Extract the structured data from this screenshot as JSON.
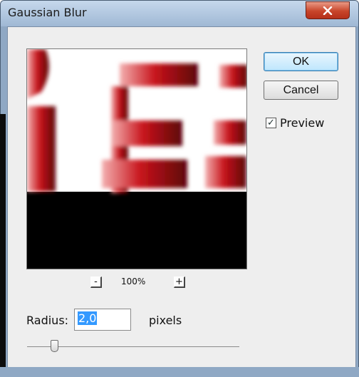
{
  "dialog": {
    "title": "Gaussian Blur",
    "close_icon": "close-icon"
  },
  "buttons": {
    "ok": "OK",
    "cancel": "Cancel"
  },
  "preview_checkbox": {
    "label": "Preview",
    "checked": true
  },
  "zoom": {
    "minus": "-",
    "level": "100%",
    "plus": "+"
  },
  "radius": {
    "label": "Radius:",
    "value": "2,0",
    "units": "pixels"
  },
  "colors": {
    "accent_selection": "#3399ff",
    "preview_red": "#b8121a"
  }
}
